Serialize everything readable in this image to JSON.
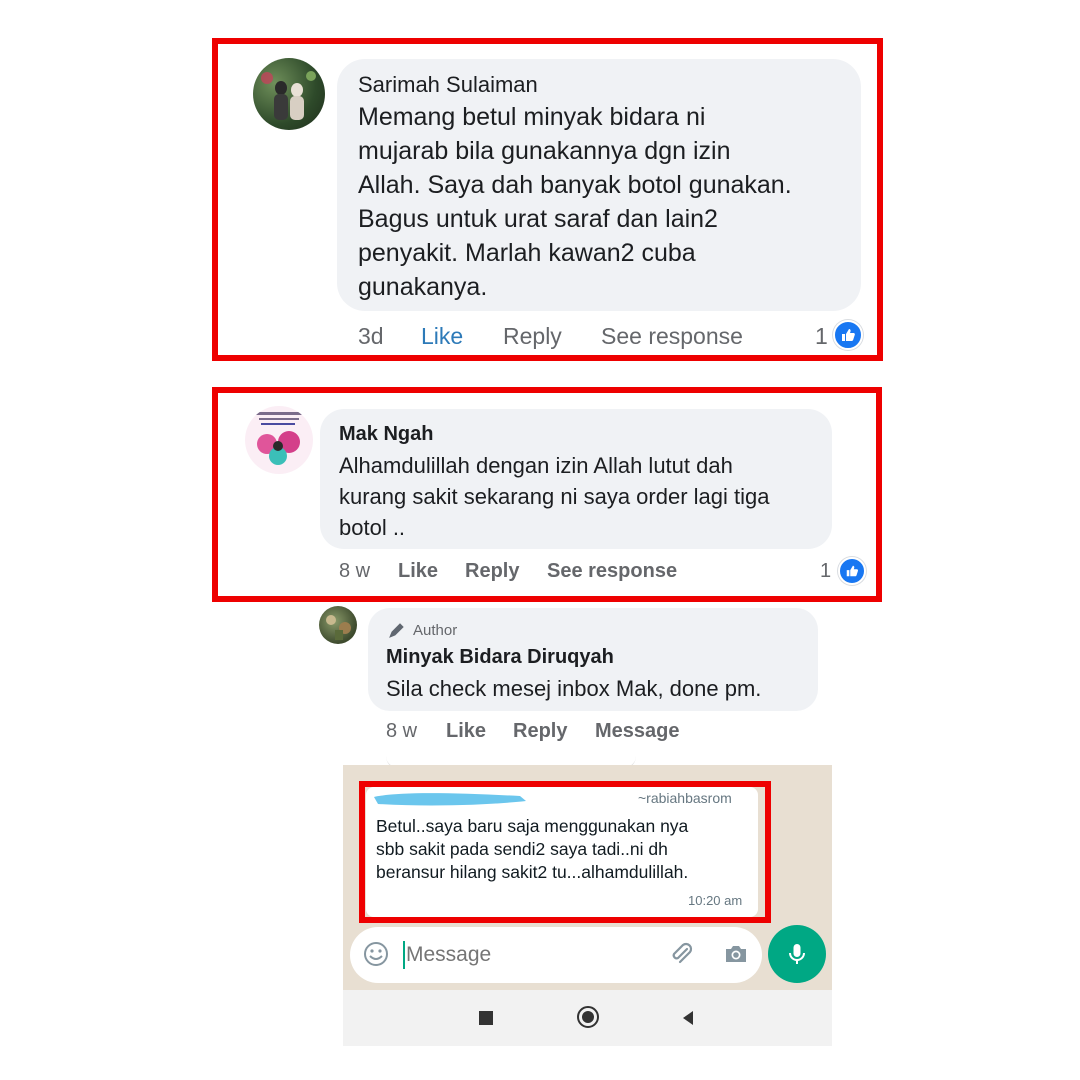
{
  "comment1": {
    "author": "Sarimah Sulaiman",
    "lines": [
      "Memang betul minyak bidara ni",
      "mujarab bila gunakannya dgn izin",
      "Allah. Saya dah banyak botol gunakan.",
      "Bagus untuk urat saraf dan lain2",
      "penyakit. Marlah kawan2 cuba",
      "gunakanya."
    ],
    "time": "3d",
    "like_label": "Like",
    "reply_label": "Reply",
    "see_response_label": "See response",
    "reaction_count": "1"
  },
  "comment2": {
    "author": "Mak Ngah",
    "lines": [
      "Alhamdulillah dengan izin Allah lutut dah",
      "kurang sakit sekarang ni saya order lagi tiga",
      "botol .."
    ],
    "time": "8 w",
    "like_label": "Like",
    "reply_label": "Reply",
    "see_response_label": "See response",
    "reaction_count": "1"
  },
  "reply": {
    "badge": "Author",
    "author": "Minyak Bidara Diruqyah",
    "text": "Sila check mesej inbox Mak, done pm.",
    "time": "8 w",
    "like_label": "Like",
    "reply_label": "Reply",
    "message_label": "Message"
  },
  "whatsapp": {
    "sender": "~rabiahbasrom",
    "lines": [
      "Betul..saya baru saja menggunakan nya",
      "sbb sakit pada sendi2 saya tadi..ni dh",
      "beransur hilang sakit2 tu...alhamdulillah."
    ],
    "time": "10:20 am",
    "input_placeholder": "Message"
  },
  "colors": {
    "highlight_border": "#ee0000",
    "facebook_blue": "#1877f2",
    "whatsapp_green": "#00a884",
    "redaction_blue": "#5bc0eb"
  }
}
